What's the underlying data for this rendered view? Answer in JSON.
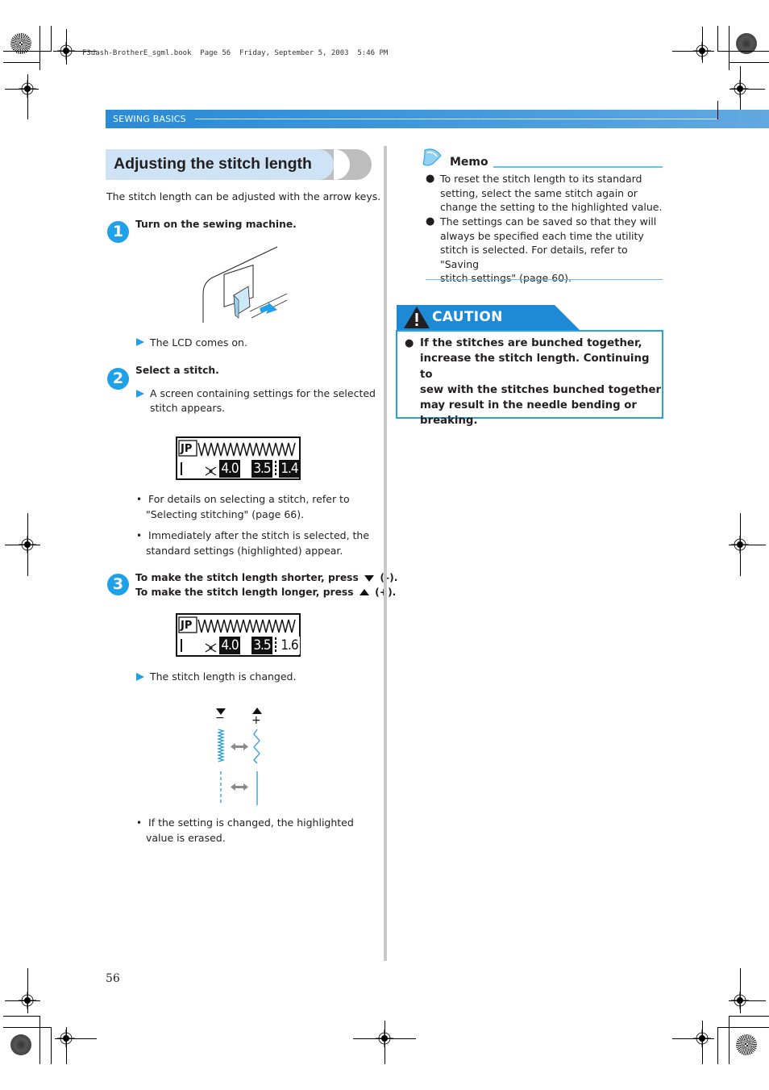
{
  "print_header": "F3dash-BrotherE_sgml.book  Page 56  Friday, September 5, 2003  5:46 PM",
  "section": {
    "label": "SEWING BASICS"
  },
  "title": "Adjusting the stitch length",
  "intro": "The stitch length can be adjusted with the arrow keys.",
  "steps": [
    {
      "number": "1",
      "title": "Turn on the sewing machine.",
      "result": "The LCD comes on."
    },
    {
      "number": "2",
      "title": "Select a stitch.",
      "result_line1": "A screen containing settings for the selected",
      "result_line2": "stitch appears.",
      "lcd": {
        "width_value": "4.0",
        "length_value": "3.5",
        "tension_value": "1.4"
      },
      "notes": [
        {
          "line1": "For details on selecting a stitch, refer to",
          "line2": "\"Selecting stitching\" (page 66)."
        },
        {
          "line1": "Immediately after the stitch is selected, the",
          "line2": "standard settings (highlighted) appear."
        }
      ]
    },
    {
      "number": "3",
      "title_line1_a": "To make the stitch length shorter, press",
      "title_line1_b": "(–).",
      "title_line2_a": "To make the stitch length longer, press",
      "title_line2_b": "(+).",
      "lcd": {
        "width_value": "4.0",
        "length_value": "3.5",
        "tension_value": "1.6"
      },
      "result": "The stitch length is changed.",
      "diagram": {
        "minus_label": "−",
        "plus_label": "+"
      },
      "note": {
        "line1": "If the setting is changed, the highlighted",
        "line2": "value is erased."
      }
    }
  ],
  "memo": {
    "title": "Memo",
    "items": [
      {
        "lines": [
          "To reset the stitch length to its standard",
          "setting, select the same stitch again or",
          "change the setting to the highlighted value."
        ]
      },
      {
        "lines": [
          "The settings can be saved so that they will",
          "always be specified each time the utility",
          "stitch is selected. For details, refer to \"Saving",
          "stitch settings\" (page 60)."
        ]
      }
    ]
  },
  "caution": {
    "title": "CAUTION",
    "lines": [
      "If the stitches are bunched together,",
      "increase the stitch length. Continuing to",
      "sew with the stitches bunched together",
      "may result in the needle bending or",
      "breaking."
    ]
  },
  "page_number": "56",
  "colors": {
    "accent_blue": "#1ea1e8",
    "section_bar": "#2a8bd6",
    "title_bg": "#cfe3f6",
    "caution_blue": "#25a3e3"
  }
}
